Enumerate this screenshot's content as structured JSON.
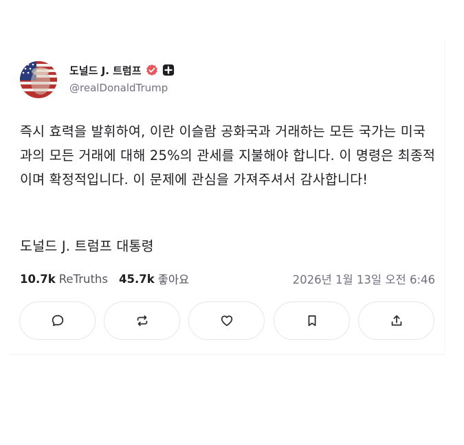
{
  "post": {
    "author": {
      "display_name": "도널드 J. 트럼프",
      "handle": "@realDonaldTrump",
      "verified_icon": "verified-badge-icon",
      "plus_icon": "truth-plus-icon",
      "verified_color": "#e5565f"
    },
    "body": "즉시 효력을 발휘하여, 이란 이슬람 공화국과 거래하는 모든 국가는 미국과의 모든 거래에 대해 25%의 관세를 지불해야 합니다. 이 명령은 최종적이며 확정적입니다. 이 문제에 관심을 가져주셔서 감사합니다!",
    "signature": "도널드 J. 트럼프 대통령",
    "stats": {
      "retruths_count": "10.7k",
      "retruths_label": "ReTruths",
      "likes_count": "45.7k",
      "likes_label": "좋아요",
      "timestamp": "2026년 1월 13일 오전 6:46"
    },
    "actions": [
      {
        "name": "reply",
        "icon": "comment-icon"
      },
      {
        "name": "retruth",
        "icon": "retruth-icon"
      },
      {
        "name": "like",
        "icon": "heart-icon"
      },
      {
        "name": "bookmark",
        "icon": "bookmark-icon"
      },
      {
        "name": "share",
        "icon": "share-icon"
      }
    ]
  }
}
